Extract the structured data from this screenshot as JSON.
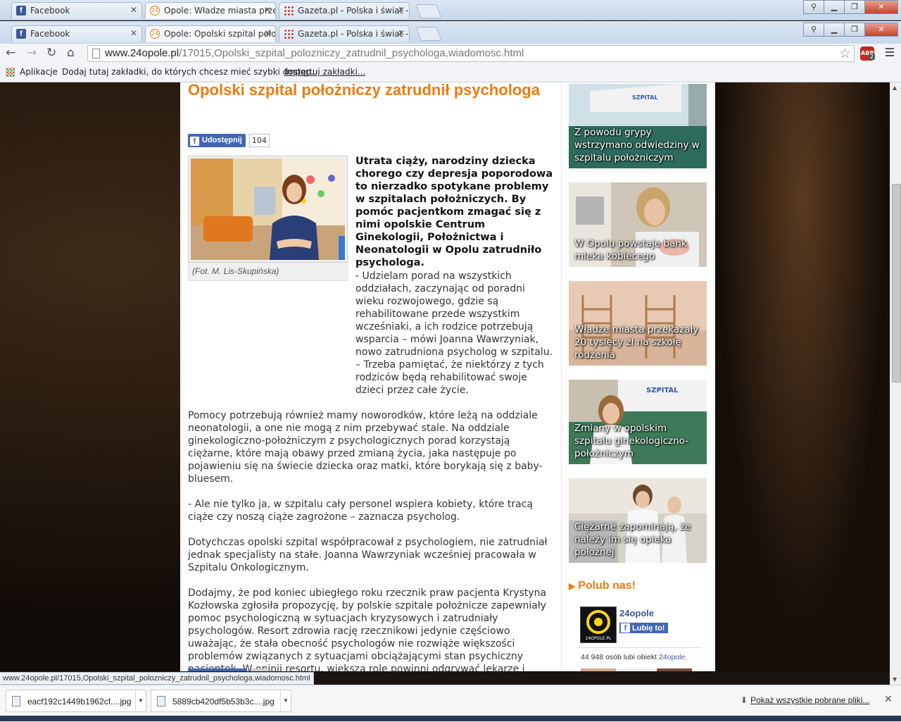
{
  "browser": {
    "back_tabs": [
      {
        "label": "Facebook",
        "favicon": "facebook-icon"
      },
      {
        "label": "Opole: Władze miasta prze",
        "favicon": "24opole-icon"
      },
      {
        "label": "Gazeta.pl - Polska i świat -",
        "favicon": "gazeta-icon"
      }
    ],
    "tabs": [
      {
        "label": "Facebook",
        "favicon": "facebook-icon"
      },
      {
        "label": "Opole: Opolski szpital poło",
        "favicon": "24opole-icon"
      },
      {
        "label": "Gazeta.pl - Polska i świat -",
        "favicon": "gazeta-icon"
      }
    ],
    "url_host": "www.24opole.pl",
    "url_path": "/17015,Opolski_szpital_polozniczy_zatrudnil_psychologa,wiadomosc.html",
    "abp_label": "ABP",
    "abp_count": "2",
    "bookmarks": {
      "apps_label": "Aplikacje",
      "hint": "Dodaj tutaj zakładki, do których chcesz mieć szybki dostęp.",
      "import_link": "Importuj zakładki..."
    },
    "status_url": "www.24opole.pl/17015,Opolski_szpital_polozniczy_zatrudnil_psychologa,wiadomosc.html"
  },
  "article": {
    "title": "Opolski szpital położniczy zatrudnił psychologa",
    "share_label": "Udostępnij",
    "share_count": "104",
    "photo_caption": "(Fot. M. Lis-Skupińska)",
    "lead": "Utrata ciąży, narodziny dziecka chorego czy depresja poporodowa to nierzadko spotykane problemy w szpitalach położniczych. By pomóc pacjentkom zmagać się z nimi opolskie Centrum Ginekologii, Położnictwa i Neonatologii w Opolu zatrudniło psychologa.",
    "paragraphs": [
      "- Udzielam porad na wszystkich oddziałach, zaczynając od poradni wieku rozwojowego, gdzie są rehabilitowane przede wszystkim wcześniaki, a ich rodzice potrzebują wsparcia – mówi Joanna Wawrzyniak, nowo zatrudniona psycholog w szpitalu. – Trzeba pamiętać, że niektórzy z tych rodziców będą rehabilitować swoje dzieci przez całe życie.",
      "Pomocy potrzebują również mamy noworodków, które leżą na oddziale neonatologii, a one nie mogą z nim przebywać stale. Na oddziale ginekologiczno-położniczym z psychologicznych porad korzystają ciężarne, które mają obawy przed zmianą życia, jaka następuje po pojawieniu się na świecie dziecka oraz matki, które borykają się z baby-bluesem.",
      "- Ale nie tylko ja, w szpitalu cały personel wspiera kobiety, które tracą ciąże czy noszą ciąże zagrożone – zaznacza psycholog.",
      "Dotychczas opolski szpital współpracował z psychologiem, nie zatrudniał jednak specjalisty na stałe. Joanna Wawrzyniak wcześniej pracowała w Szpitalu Onkologicznym.",
      "Dodajmy, że pod koniec ubiegłego roku rzecznik praw pacjenta Krystyna Kozłowska zgłosiła propozycję, by polskie szpitale położnicze zapewniały pomoc psychologiczną w sytuacjach kryzysowych i zatrudniały psychologów. Resort zdrowia rację rzecznikowi jedynie częściowo uważając, że stała obecność psychologów nie rozwiąże większości problemów związanych z sytuacjami obciążającymi stan psychiczny pacjentek. W opinii resortu, większą rolę powinni odgrywać lekarze i położne - ich zadaniem ma być przygotowanie pacjentek do porodu, a także uśmierzanie bólu."
    ]
  },
  "sidebar": {
    "related": [
      {
        "caption": "Z powodu grypy wstrzymano odwiedziny w szpitalu położniczym",
        "sign_text": "SZPITAL"
      },
      {
        "caption": "W Opolu powstaje bank mleka kobiecego"
      },
      {
        "caption": "Władze miasta przekazały 20 tysięcy zł na szkołę rodzenia"
      },
      {
        "caption": "Zmiany w opolskim szpitalu ginekologiczno-położniczym",
        "sign_text": "SZPITAL"
      },
      {
        "caption": "Ciężarne zapominają, że należy im się opieka położnej"
      }
    ],
    "like_heading": "Polub nas!",
    "fb_page_name": "24opole",
    "fb_logo_text": "24OPOLE.PL",
    "fb_like_label": "Lubię to!",
    "fb_count_text": "44 948 osób lubi obiekt ",
    "fb_count_page": "24opole."
  },
  "downloads": {
    "items": [
      {
        "name": "eacf192c1449b1962cf....jpg"
      },
      {
        "name": "5889cb420df5b53b3c....jpg"
      }
    ],
    "show_all": "Pokaż wszystkie pobrane pliki..."
  },
  "colors": {
    "accent": "#f07a10",
    "facebook": "#4267b2"
  }
}
